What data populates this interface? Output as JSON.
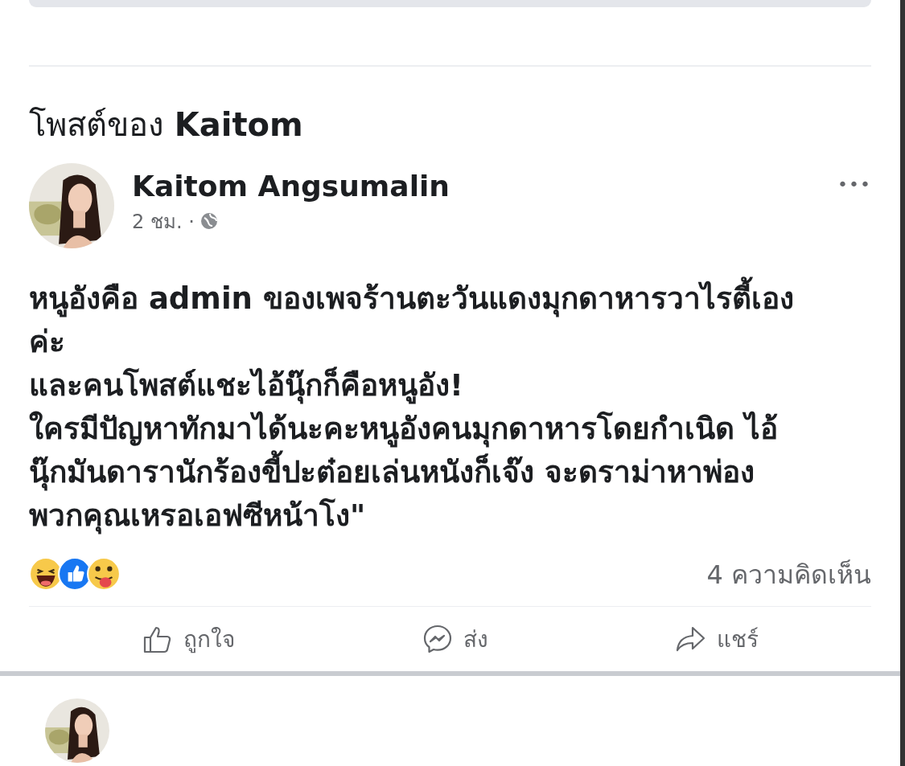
{
  "section_title": "โพสต์ของ **Kaitom**",
  "post": {
    "author": "Kaitom Angsumalin",
    "time": "2 ชม. ·",
    "more": "•••",
    "lines": [
      "หนูอังคือ admin ของเพจร้านตะวันแดงมุกดาหารวาไรตี้เอง",
      "ค่ะ",
      "และคนโพสต์แชะไอ้นุ๊กก็คือหนูอัง!",
      "ใครมีปัญหาทักมาได้นะคะหนูอังคนมุกดาหารโดยกำเนิด ไอ้",
      "นุ๊กมันดารานักร้องขี้ปะต๋อยเล่นหนังก็เจ๊ง จะดราม่าหาพ่อง",
      "พวกคุณเหรอเอฟซีหน้าโง\""
    ],
    "reactions": [
      {
        "kind": "haha"
      },
      {
        "kind": "like"
      },
      {
        "kind": "tongue"
      }
    ],
    "comments": "4 ความคิดเห็น",
    "actions": [
      {
        "kind": "like",
        "label": "ถูกใจ"
      },
      {
        "kind": "send",
        "label": "ส่ง"
      },
      {
        "kind": "share",
        "label": "แชร์"
      }
    ]
  }
}
